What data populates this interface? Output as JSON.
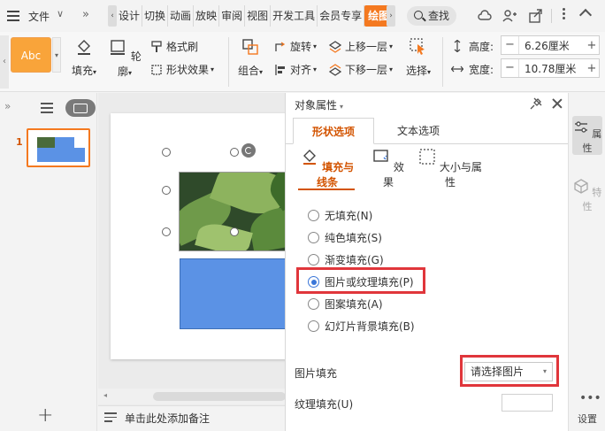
{
  "topbar": {
    "file_label": "文件",
    "tabs": [
      "设计",
      "切换",
      "动画",
      "放映",
      "审阅",
      "视图",
      "开发工具",
      "会员专享",
      "绘图"
    ],
    "active_tab": "绘图",
    "search_label": "查找"
  },
  "ribbon": {
    "style_preview": "Abc",
    "fill_label": "填充",
    "outline_label": "轮廓",
    "format_brush_label": "格式刷",
    "shape_effect_label": "形状效果",
    "group_label": "组合",
    "rotate_label": "旋转",
    "align_label": "对齐",
    "bring_forward_label": "上移一层",
    "send_backward_label": "下移一层",
    "select_label": "选择",
    "height_label": "高度:",
    "height_value": "6.26厘米",
    "width_label": "宽度:",
    "width_value": "10.78厘米"
  },
  "thumbnails": {
    "slide_number": "1"
  },
  "notes": {
    "placeholder": "单击此处添加备注"
  },
  "properties": {
    "title": "对象属性",
    "tabs": [
      "形状选项",
      "文本选项"
    ],
    "subtabs": [
      "填充与线条",
      "效果",
      "大小与属性"
    ],
    "fill_options": [
      {
        "label": "无填充(N)",
        "checked": false
      },
      {
        "label": "纯色填充(S)",
        "checked": false
      },
      {
        "label": "渐变填充(G)",
        "checked": false
      },
      {
        "label": "图片或纹理填充(P)",
        "checked": true
      },
      {
        "label": "图案填充(A)",
        "checked": false
      },
      {
        "label": "幻灯片背景填充(B)",
        "checked": false
      }
    ],
    "picture_fill_label": "图片填充",
    "picture_fill_value": "请选择图片",
    "texture_fill_label": "纹理填充(U)"
  },
  "right_strip": {
    "properties_label": "属性",
    "features_label": "特性",
    "settings_label": "设置"
  },
  "colors": {
    "accent": "#f47920",
    "active_text": "#d35400",
    "highlight": "#e0363b",
    "shape_blue": "#5b92e5"
  }
}
